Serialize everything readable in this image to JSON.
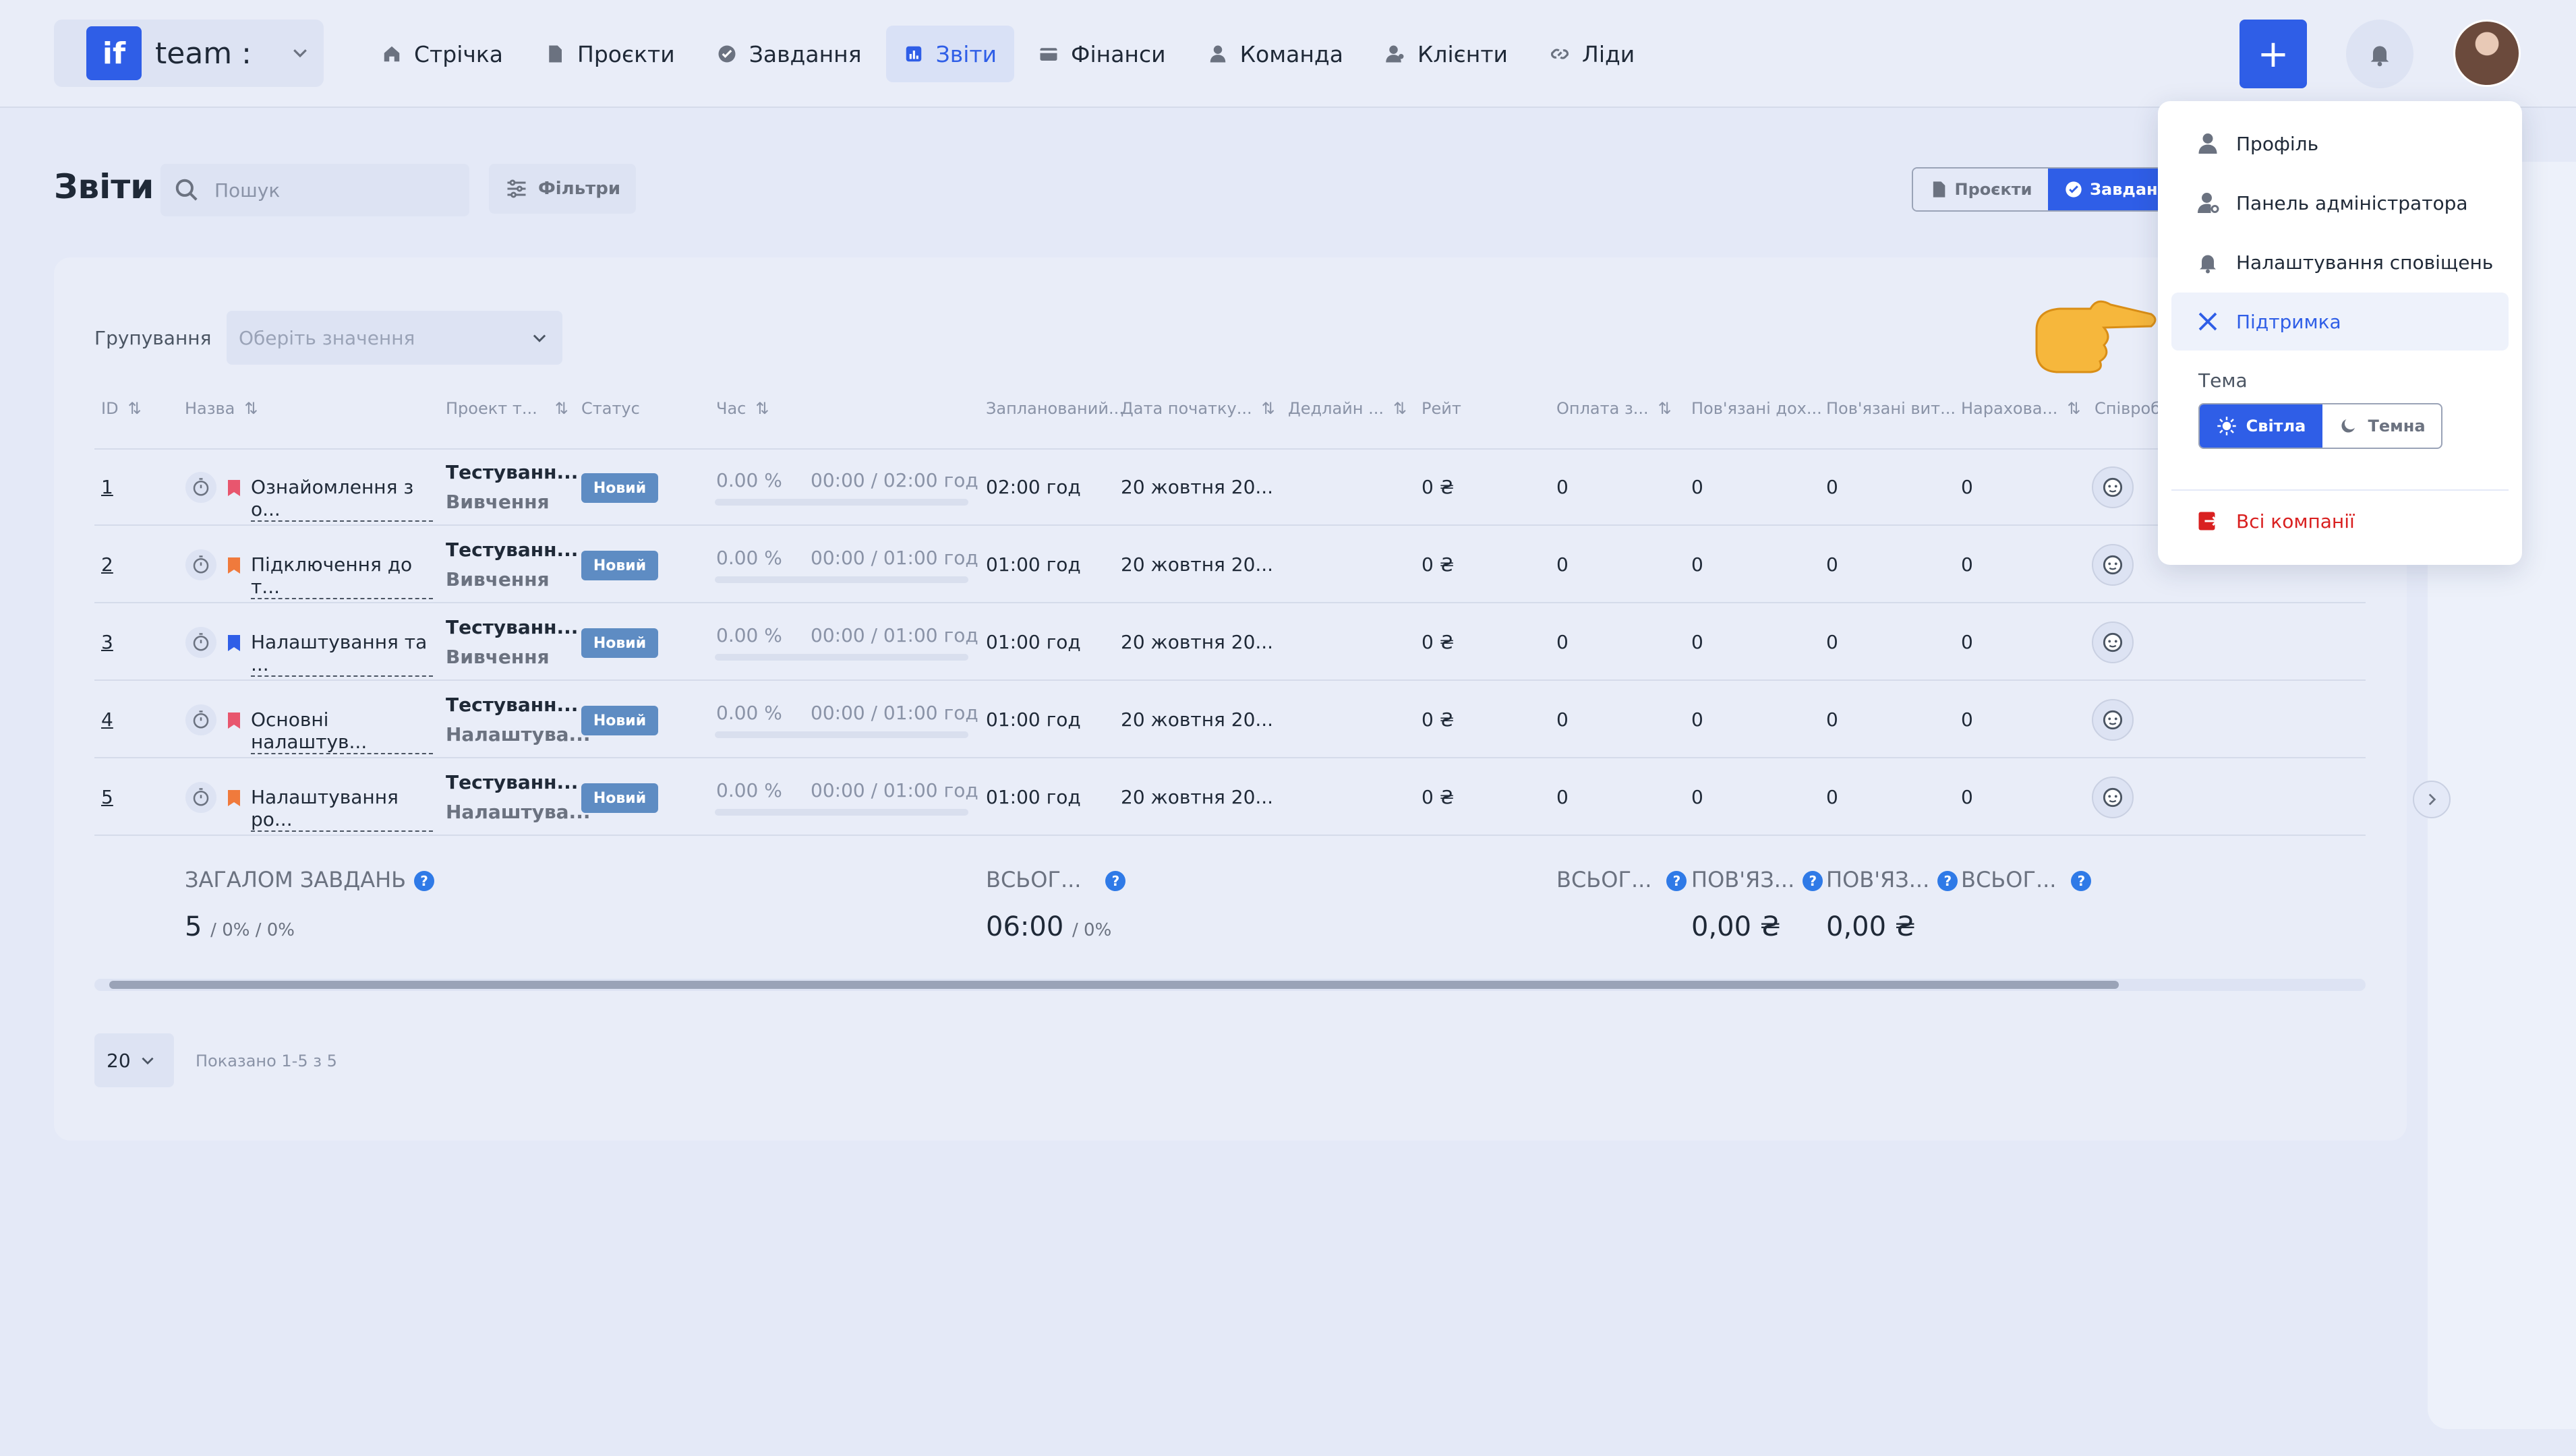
{
  "brand": {
    "logo": "if",
    "name": "team :"
  },
  "nav": [
    {
      "label": "Стрічка",
      "icon": "home-icon"
    },
    {
      "label": "Проєкти",
      "icon": "file-icon"
    },
    {
      "label": "Завдання",
      "icon": "check-circle-icon"
    },
    {
      "label": "Звіти",
      "icon": "chart-icon",
      "active": true
    },
    {
      "label": "Фінанси",
      "icon": "wallet-icon"
    },
    {
      "label": "Команда",
      "icon": "user-icon"
    },
    {
      "label": "Клієнти",
      "icon": "users-icon"
    },
    {
      "label": "Ліди",
      "icon": "link-icon"
    }
  ],
  "header": {
    "plus": "+"
  },
  "page": {
    "title": "Звіти",
    "search_placeholder": "Пошук",
    "filters_label": "Фільтри",
    "view_toggle": {
      "projects": "Проєкти",
      "tasks": "Завдання"
    }
  },
  "grouping": {
    "label": "Групування",
    "placeholder": "Оберіть значення"
  },
  "table": {
    "columns": [
      "ID",
      "Назва",
      "Проект т...",
      "Статус",
      "Час",
      "Запланований...",
      "Дата початку...",
      "Дедлайн ...",
      "Рейт",
      "Оплата з...",
      "Пов'язані дох...",
      "Пов'язані вит...",
      "Нарахова...",
      "Співроб"
    ],
    "rows": [
      {
        "id": "1",
        "name": "Ознайомлення з о...",
        "flag": "#e8566e",
        "project": "Тестуванн...",
        "project_sub": "Вивчення",
        "status": "Новий",
        "percent": "0.00 %",
        "time": "00:00 / 02:00 год",
        "planned": "02:00 год",
        "start": "20 жовтня 20...",
        "rate": "0 ₴",
        "pay": "0",
        "income": "0",
        "expense": "0",
        "accrued": "0"
      },
      {
        "id": "2",
        "name": "Підключення до т...",
        "flag": "#f07a3c",
        "project": "Тестуванн...",
        "project_sub": "Вивчення",
        "status": "Новий",
        "percent": "0.00 %",
        "time": "00:00 / 01:00 год",
        "planned": "01:00 год",
        "start": "20 жовтня 20...",
        "rate": "0 ₴",
        "pay": "0",
        "income": "0",
        "expense": "0",
        "accrued": "0"
      },
      {
        "id": "3",
        "name": "Налаштування та ...",
        "flag": "#2f5ee7",
        "project": "Тестуванн...",
        "project_sub": "Вивчення",
        "status": "Новий",
        "percent": "0.00 %",
        "time": "00:00 / 01:00 год",
        "planned": "01:00 год",
        "start": "20 жовтня 20...",
        "rate": "0 ₴",
        "pay": "0",
        "income": "0",
        "expense": "0",
        "accrued": "0"
      },
      {
        "id": "4",
        "name": "Основні налаштув...",
        "flag": "#e8566e",
        "project": "Тестуванн...",
        "project_sub": "Налаштува...",
        "status": "Новий",
        "percent": "0.00 %",
        "time": "00:00 / 01:00 год",
        "planned": "01:00 год",
        "start": "20 жовтня 20...",
        "rate": "0 ₴",
        "pay": "0",
        "income": "0",
        "expense": "0",
        "accrued": "0"
      },
      {
        "id": "5",
        "name": "Налаштування ро...",
        "flag": "#f07a3c",
        "project": "Тестуванн...",
        "project_sub": "Налаштува...",
        "status": "Новий",
        "percent": "0.00 %",
        "time": "00:00 / 01:00 год",
        "planned": "01:00 год",
        "start": "20 жовтня 20...",
        "rate": "0 ₴",
        "pay": "0",
        "income": "0",
        "expense": "0",
        "accrued": "0"
      }
    ],
    "totals": {
      "tasks_label": "ЗАГАЛОМ ЗАВДАНЬ",
      "tasks_value": "5",
      "tasks_extra": "/ 0% / 0%",
      "planned_label": "ВСЬОГ...",
      "planned_value": "06:00",
      "planned_extra": "/ 0%",
      "pay_label": "ВСЬОГ...",
      "income_label": "ПОВ'ЯЗ...",
      "income_value": "0,00 ₴",
      "expense_label": "ПОВ'ЯЗ...",
      "expense_value": "0,00 ₴",
      "accrued_label": "ВСЬОГ..."
    }
  },
  "pagination": {
    "page_size": "20",
    "shown": "Показано 1-5 з 5"
  },
  "menu": {
    "items": [
      {
        "label": "Профіль",
        "icon": "user-icon"
      },
      {
        "label": "Панель адміністратора",
        "icon": "admin-user-icon"
      },
      {
        "label": "Налаштування сповіщень",
        "icon": "bell-icon"
      },
      {
        "label": "Підтримка",
        "icon": "tools-icon",
        "active": true
      }
    ],
    "theme_label": "Тема",
    "theme_light": "Світла",
    "theme_dark": "Темна",
    "logout": "Всі компанії"
  },
  "colors": {
    "accent": "#2f5ee7",
    "badge": "#5e8cc3",
    "danger": "#d92020"
  }
}
